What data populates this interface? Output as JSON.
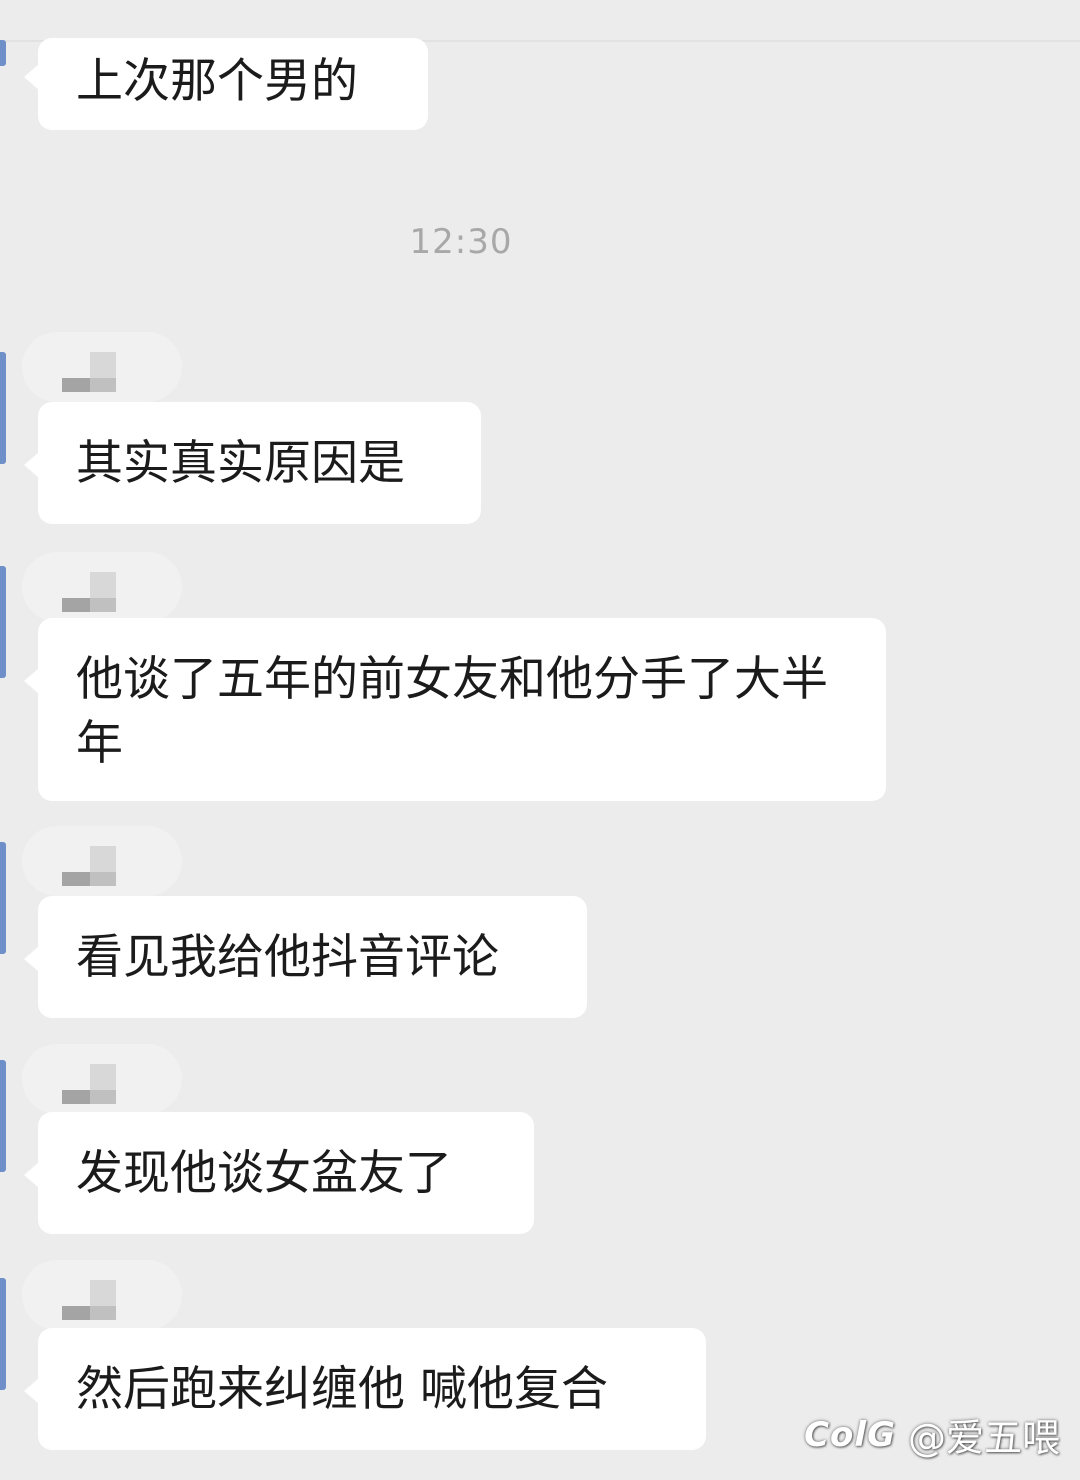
{
  "chat": {
    "messages": [
      {
        "text": "上次那个男的"
      },
      {
        "text": "其实真实原因是"
      },
      {
        "text": "他谈了五年的前女友和他分手了大半年"
      },
      {
        "text": "看见我给他抖音评论"
      },
      {
        "text": "发现他谈女盆友了"
      },
      {
        "text": "然后跑来纠缠他 喊他复合"
      }
    ],
    "timestamp": "12:30"
  },
  "watermark": {
    "logo": "ColG",
    "handle": "@爱五喂"
  }
}
